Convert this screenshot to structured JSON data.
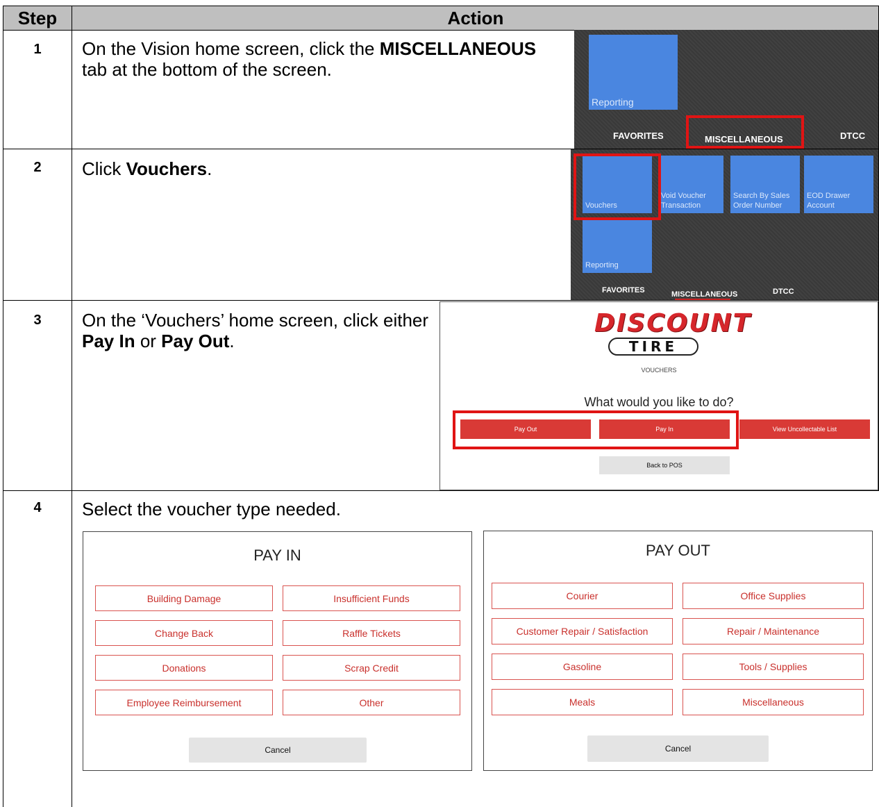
{
  "header": {
    "step": "Step",
    "action": "Action"
  },
  "steps": [
    {
      "num": "1",
      "pre": "On the Vision home screen, click the ",
      "bold": "MISCELLANEOUS",
      "post": " tab at the bottom of the screen."
    },
    {
      "num": "2",
      "pre": "Click ",
      "bold": "Vouchers",
      "post": "."
    },
    {
      "num": "3",
      "pre": "On the ‘Vouchers’ home screen, click either ",
      "bold": "Pay In",
      "mid": " or ",
      "bold2": "Pay Out",
      "post": "."
    },
    {
      "num": "4",
      "text": "Select the voucher type needed."
    }
  ],
  "shot1": {
    "tile": "Reporting",
    "tabs": [
      "FAVORITES",
      "MISCELLANEOUS",
      "DTCC"
    ]
  },
  "shot2": {
    "tiles": [
      "Vouchers",
      "Void Voucher Transaction",
      "Search By Sales Order Number",
      "EOD Drawer Account",
      "Reporting"
    ],
    "tabs": [
      "FAVORITES",
      "MISCELLANEOUS",
      "DTCC"
    ]
  },
  "shot3": {
    "logo_top": "DISCOUNT",
    "logo_bottom": "TIRE",
    "subtitle": "VOUCHERS",
    "question": "What would you like to do?",
    "buttons": [
      "Pay Out",
      "Pay In",
      "View Uncollectable List"
    ],
    "back": "Back to POS"
  },
  "pay_in": {
    "title": "PAY IN",
    "options": [
      "Building Damage",
      "Insufficient Funds",
      "Change Back",
      "Raffle Tickets",
      "Donations",
      "Scrap Credit",
      "Employee Reimbursement",
      "Other"
    ],
    "cancel": "Cancel"
  },
  "pay_out": {
    "title": "PAY OUT",
    "options": [
      "Courier",
      "Office Supplies",
      "Customer Repair / Satisfaction",
      "Repair / Maintenance",
      "Gasoline",
      "Tools / Supplies",
      "Meals",
      "Miscellaneous"
    ],
    "cancel": "Cancel"
  },
  "colors": {
    "accent_red": "#e01414",
    "tile_blue": "#4a86e0",
    "header_grey": "#bfbfbf"
  }
}
